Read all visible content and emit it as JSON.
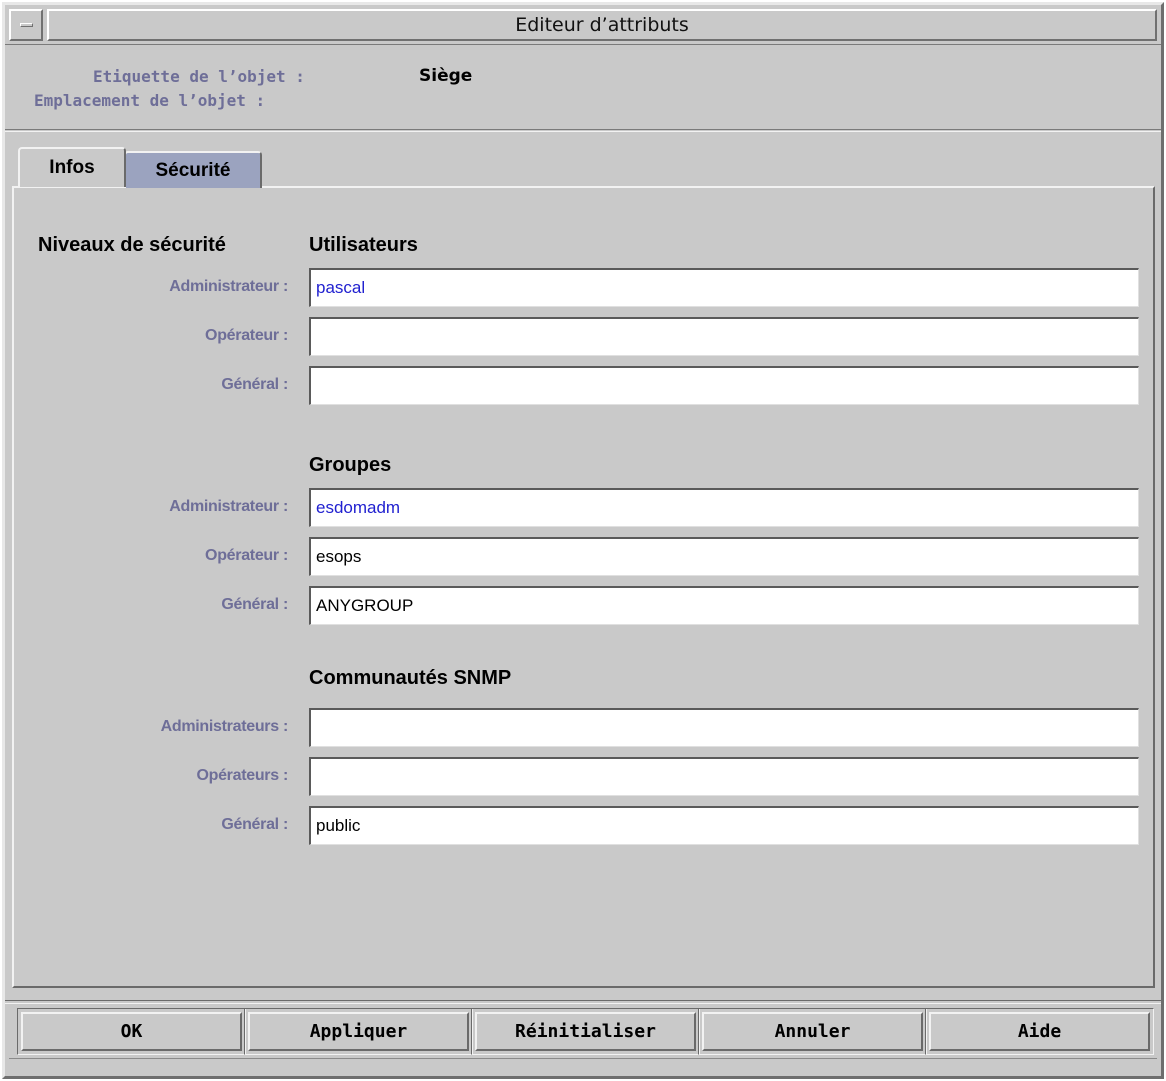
{
  "window": {
    "title": "Editeur d’attributs"
  },
  "header": {
    "label_etiquette": "Etiquette de l’objet :",
    "value_etiquette": "Siège",
    "label_emplacement": "Emplacement de l’objet :",
    "value_emplacement": ""
  },
  "tabs": [
    {
      "label": "Infos",
      "selected": false
    },
    {
      "label": "Sécurité",
      "selected": true
    }
  ],
  "security": {
    "levels_heading": "Niveaux de sécurité",
    "users": {
      "heading": "Utilisateurs",
      "admin_label": "Administrateur :",
      "admin_value": "pascal",
      "operator_label": "Opérateur :",
      "operator_value": "",
      "general_label": "Général :",
      "general_value": ""
    },
    "groups": {
      "heading": "Groupes",
      "admin_label": "Administrateur :",
      "admin_value": "esdomadm",
      "operator_label": "Opérateur :",
      "operator_value": "esops",
      "general_label": "Général :",
      "general_value": "ANYGROUP"
    },
    "snmp": {
      "heading": "Communautés SNMP",
      "admin_label": "Administrateurs :",
      "admin_value": "",
      "operator_label": "Opérateurs :",
      "operator_value": "",
      "general_label": "Général :",
      "general_value": "public"
    }
  },
  "buttons": {
    "ok": "OK",
    "apply": "Appliquer",
    "reset": "Réinitialiser",
    "cancel": "Annuler",
    "help": "Aide"
  },
  "colors": {
    "window_bg": "#c9c9c9",
    "label_color": "#6e6e98",
    "selected_tab": "#9ba3bf",
    "link_value": "#2121d0"
  }
}
